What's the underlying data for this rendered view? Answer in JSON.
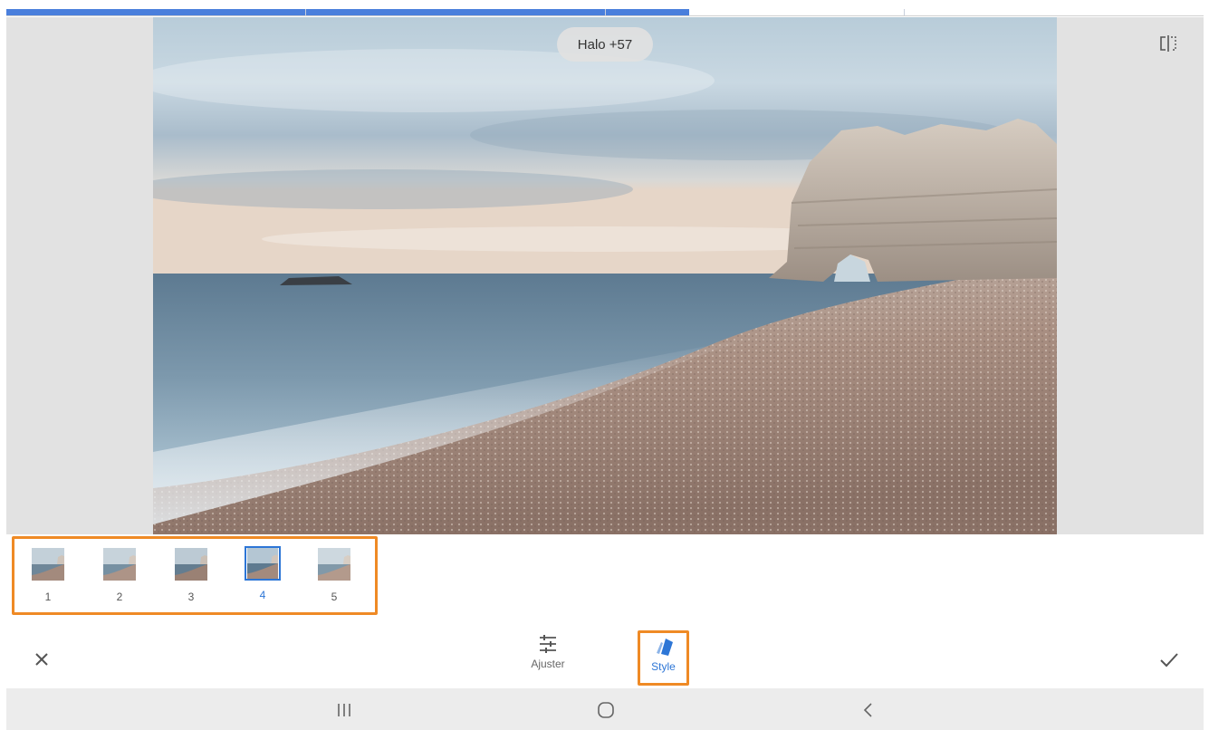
{
  "colors": {
    "accent": "#2d76d6",
    "highlight": "#ef8a25",
    "strip_blue": "#4a7fdc"
  },
  "top_strip": {
    "segments": 4,
    "progress_segments": 3
  },
  "canvas": {
    "overlay_label": "Halo +57",
    "compare_icon": "compare-split-icon"
  },
  "presets": {
    "items": [
      {
        "label": "1",
        "selected": false
      },
      {
        "label": "2",
        "selected": false
      },
      {
        "label": "3",
        "selected": false
      },
      {
        "label": "4",
        "selected": true
      },
      {
        "label": "5",
        "selected": false
      }
    ]
  },
  "toolbar": {
    "cancel_icon": "close-icon",
    "apply_icon": "checkmark-icon",
    "tabs": [
      {
        "label": "Ajuster",
        "icon": "sliders-icon",
        "active": false
      },
      {
        "label": "Style",
        "icon": "style-cards-icon",
        "active": true
      }
    ]
  },
  "navbar": {
    "recents_icon": "recents-icon",
    "home_icon": "home-icon",
    "back_icon": "back-icon"
  }
}
